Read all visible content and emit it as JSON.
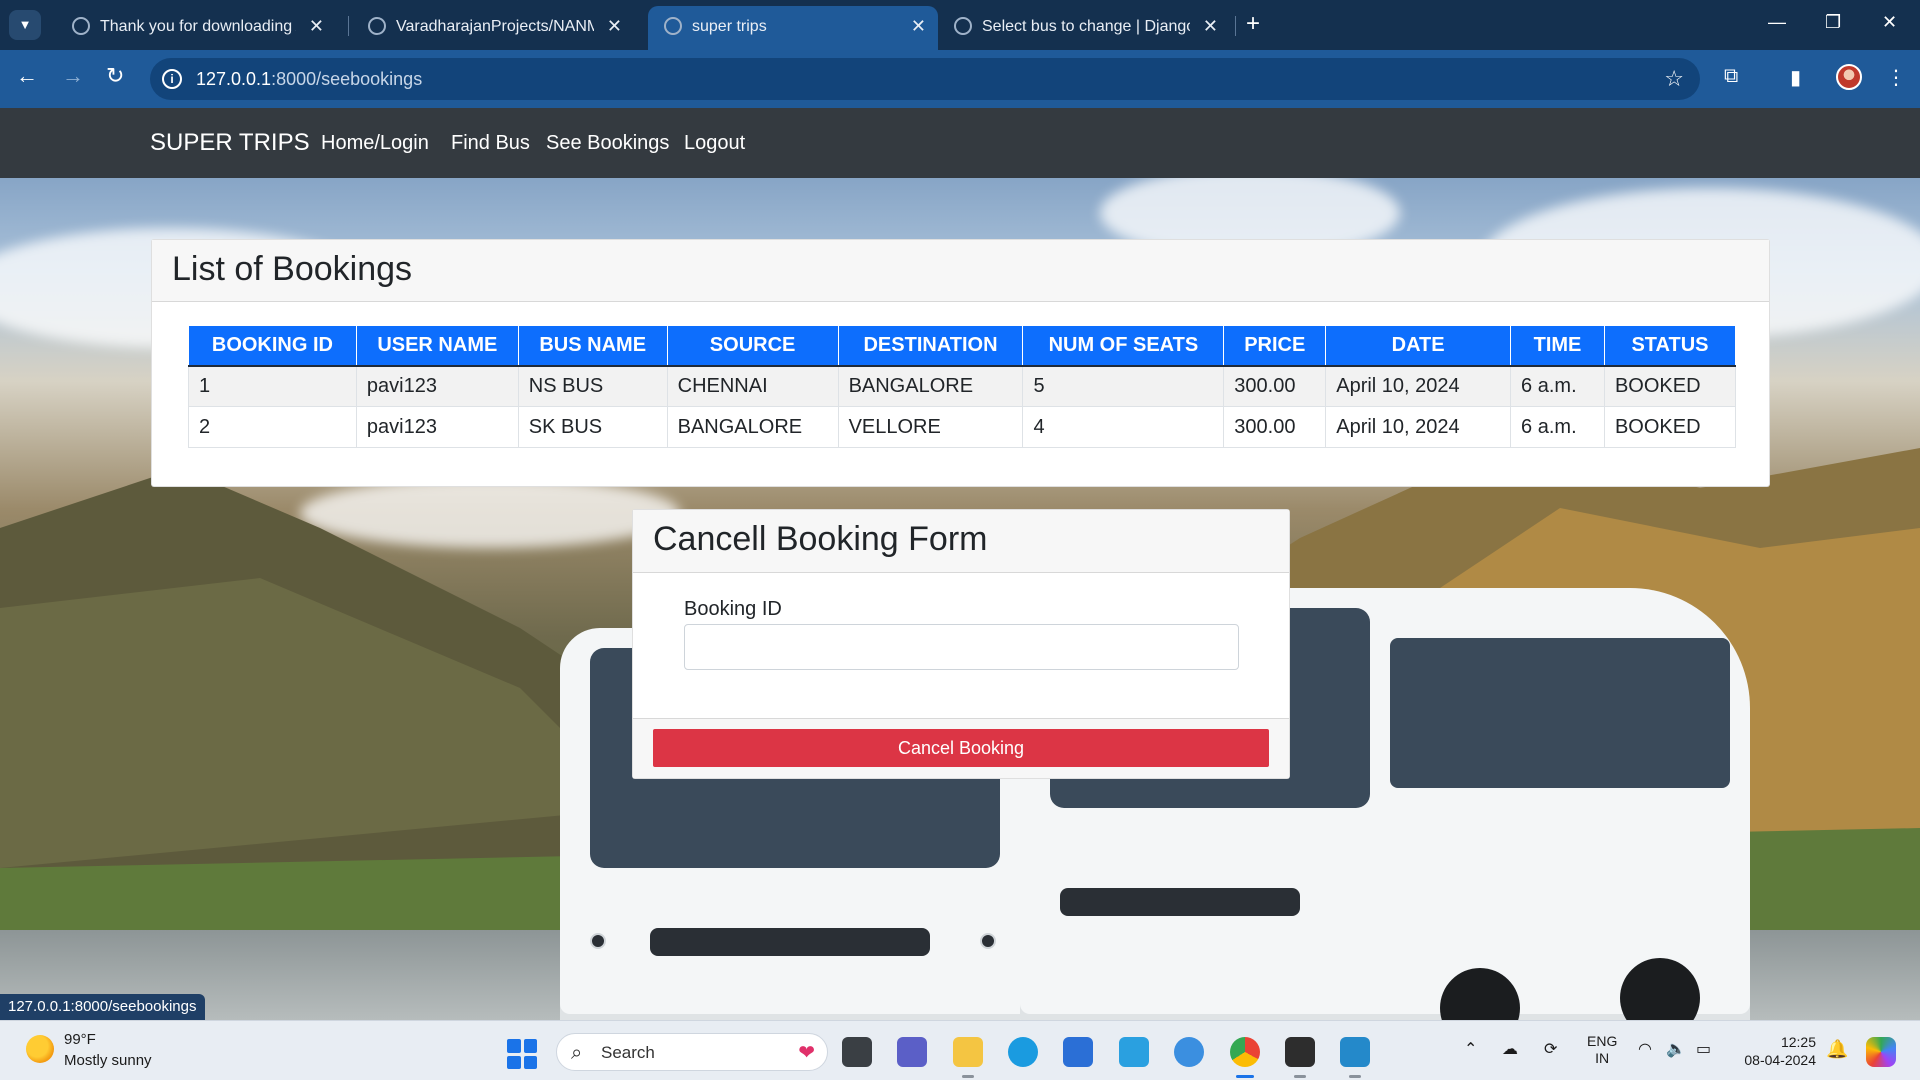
{
  "browser": {
    "tabs": [
      {
        "title": "Thank you for downloading Any",
        "active": false
      },
      {
        "title": "VaradharajanProjects/NANMUD",
        "active": false
      },
      {
        "title": "super trips",
        "active": true
      },
      {
        "title": "Select bus to change | Django s",
        "active": false
      }
    ],
    "url_host": "127.0.0.1",
    "url_path": ":8000/seebookings",
    "status_url": "127.0.0.1:8000/seebookings"
  },
  "navbar": {
    "brand": "SUPER TRIPS",
    "links": [
      "Home/Login",
      "Find Bus",
      "See Bookings",
      "Logout"
    ]
  },
  "bookings": {
    "title": "List of Bookings",
    "columns": [
      "BOOKING ID",
      "USER NAME",
      "BUS NAME",
      "SOURCE",
      "DESTINATION",
      "NUM OF SEATS",
      "PRICE",
      "DATE",
      "TIME",
      "STATUS"
    ],
    "rows": [
      [
        "1",
        "pavi123",
        "NS BUS",
        "CHENNAI",
        "BANGALORE",
        "5",
        "300.00",
        "April 10, 2024",
        "6 a.m.",
        "BOOKED"
      ],
      [
        "2",
        "pavi123",
        "SK BUS",
        "BANGALORE",
        "VELLORE",
        "4",
        "300.00",
        "April 10, 2024",
        "6 a.m.",
        "BOOKED"
      ]
    ],
    "header_color": "#0d6efd"
  },
  "cancel_form": {
    "title": "Cancell Booking Form",
    "field_label": "Booking ID",
    "field_value": "",
    "button_label": "Cancel Booking",
    "button_color": "#dc3545"
  },
  "taskbar": {
    "weather_temp": "99°F",
    "weather_desc": "Mostly sunny",
    "search_placeholder": "Search",
    "lang_line1": "ENG",
    "lang_line2": "IN",
    "time": "12:25",
    "date": "08-04-2024"
  },
  "icons": {
    "tab_menu": "chevron-down-icon",
    "back": "arrow-left-icon",
    "forward": "arrow-right-icon",
    "reload": "reload-icon",
    "site_info": "info-icon",
    "bookmark": "star-icon",
    "extensions": "puzzle-icon",
    "sidepanel": "side-panel-icon",
    "menu": "kebab-menu-icon",
    "start": "windows-start-icon",
    "search": "search-icon",
    "notifications": "bell-icon"
  }
}
